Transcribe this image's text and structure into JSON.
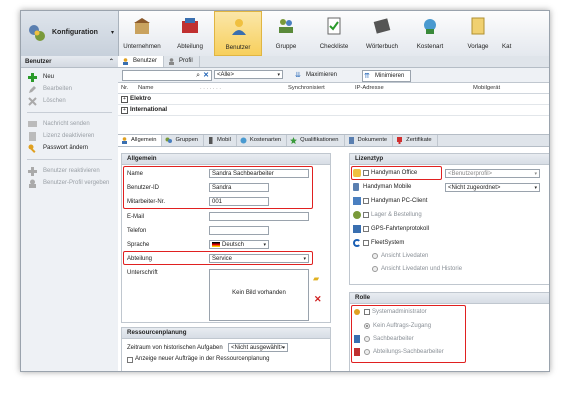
{
  "nav": {
    "config_label": "Konfiguration",
    "items": [
      {
        "label": "Unternehmen"
      },
      {
        "label": "Abteilung"
      },
      {
        "label": "Benutzer"
      },
      {
        "label": "Gruppe"
      },
      {
        "label": "Checkliste"
      },
      {
        "label": "Wörterbuch"
      },
      {
        "label": "Kostenart"
      },
      {
        "label": "Vorlage"
      },
      {
        "label": "Kat"
      }
    ]
  },
  "sidebar": {
    "title": "Benutzer",
    "actions": {
      "neu": "Neu",
      "bearbeiten": "Bearbeiten",
      "loeschen": "Löschen",
      "nachricht": "Nachricht senden",
      "lizenz": "Lizenz deaktivieren",
      "passwort": "Passwort ändern",
      "reaktivieren": "Benutzer reaktivieren",
      "profil_vergeben": "Benutzer-Profil vergeben"
    }
  },
  "tabs_top": {
    "benutzer": "Benutzer",
    "profil": "Profil"
  },
  "toolbar": {
    "filter": "<Alle>",
    "maximize": "Maximieren",
    "minimize": "Minimieren"
  },
  "grid": {
    "headers": {
      "nr": "Nr.",
      "name": "Name",
      "dots": ". . . . . . .",
      "sync": "Synchronisiert",
      "ip": "IP-Adresse",
      "device": "Mobilgerät"
    },
    "groups": [
      "Elektro",
      "International"
    ]
  },
  "detail_tabs": [
    "Allgemein",
    "Gruppen",
    "Mobil",
    "Kostenarten",
    "Qualifikationen",
    "Dokumente",
    "Zertifikate"
  ],
  "allgemein": {
    "title": "Allgemein",
    "fields": {
      "name_label": "Name",
      "name_value": "Sandra Sachbearbeiter",
      "bid_label": "Benutzer-ID",
      "bid_value": "Sandra",
      "mnr_label": "Mitarbeiter-Nr.",
      "mnr_value": "001",
      "email_label": "E-Mail",
      "tel_label": "Telefon",
      "lang_label": "Sprache",
      "lang_value": "Deutsch",
      "dept_label": "Abteilung",
      "dept_value": "Service",
      "sig_label": "Unterschrift",
      "sig_empty": "Kein Bild vorhanden"
    }
  },
  "ressourcen": {
    "title": "Ressourcenplanung",
    "zeitraum_label": "Zeitraum von historischen Aufgaben",
    "zeitraum_value": "<Nicht ausgewählt>",
    "anzeige_label": "Anzeige neuer Aufträge in der Ressourcenplanung"
  },
  "lizenz": {
    "title": "Lizenztyp",
    "office": "Handyman Office",
    "office_select": "<Benutzerprofil>",
    "mobile": "Handyman Mobile",
    "mobile_select": "<Nicht zugeordnet>",
    "pc": "Handyman PC-Client",
    "lager": "Lager & Bestellung",
    "gps": "GPS-Fahrtenprotokoll",
    "fleet": "FleetSystem",
    "livedaten": "Ansicht Livedaten",
    "livedaten_hist": "Ansicht Livedaten und Historie"
  },
  "rolle": {
    "title": "Rolle",
    "sysadmin": "Systemadministrator",
    "kein": "Kein Auftrags-Zugang",
    "sachbearbeiter": "Sachbearbeiter",
    "abteilung": "Abteilungs-Sachbearbeiter"
  },
  "colors": {
    "highlight_red": "#e02020",
    "active_tab": "#f7cf5c",
    "accent_blue": "#1a5fb4"
  }
}
